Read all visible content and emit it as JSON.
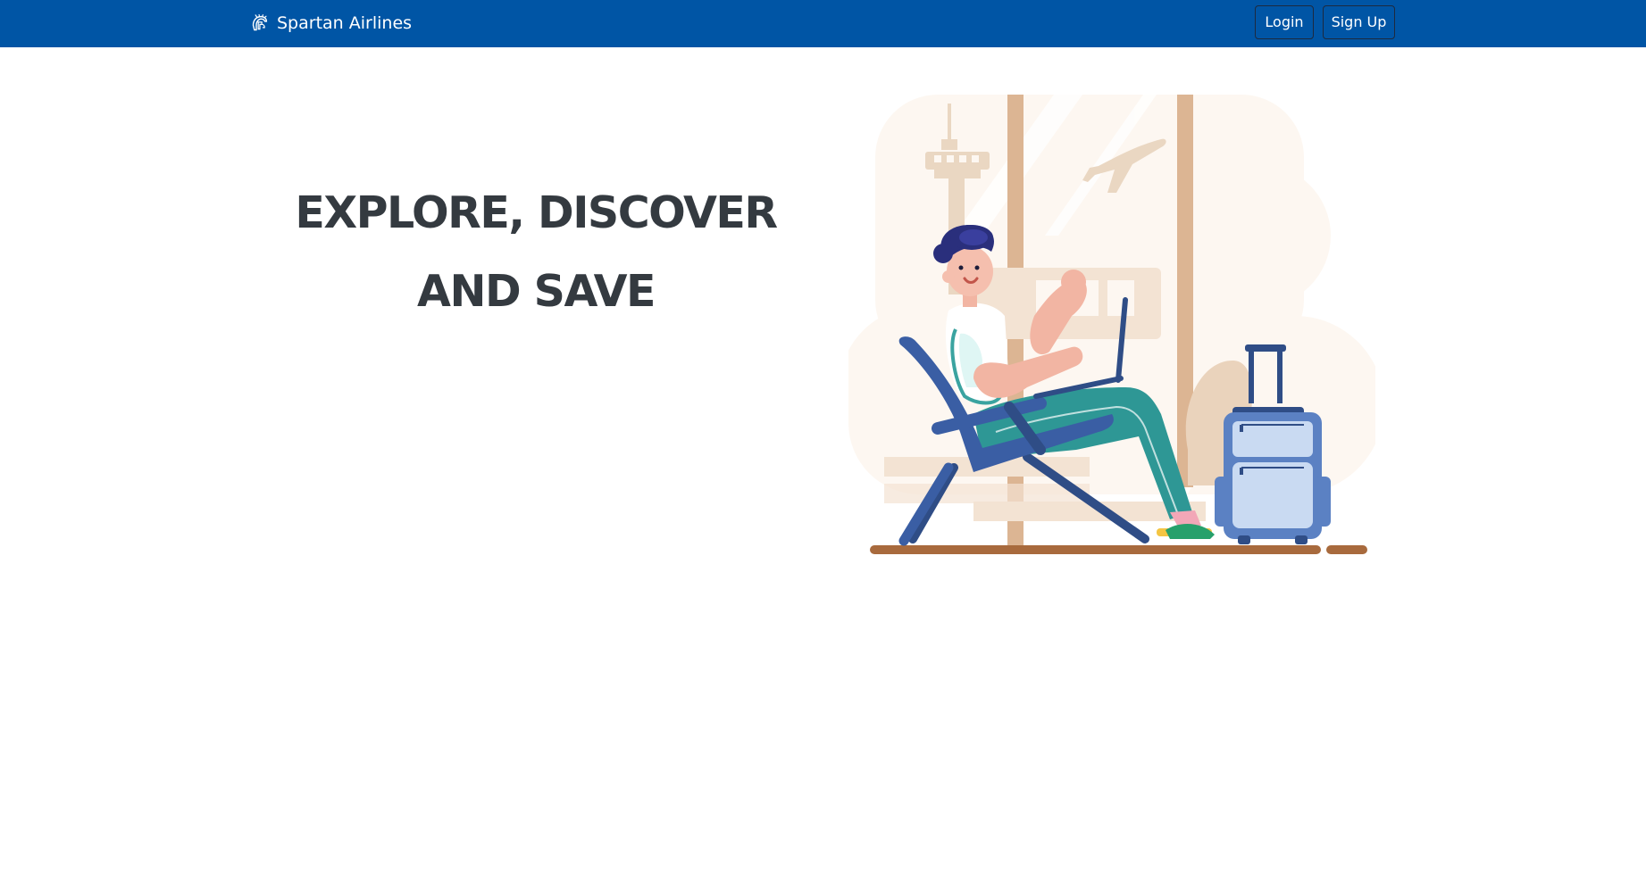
{
  "navbar": {
    "brand_name": "Spartan Airlines",
    "brand_icon": "spartan-helmet-icon",
    "login_label": "Login",
    "signup_label": "Sign Up",
    "background_color": "#0055a5"
  },
  "hero": {
    "title_line1": "EXPLORE, DISCOVER",
    "title_line2": "AND SAVE",
    "text_color": "#343a40",
    "illustration": "traveler-with-laptop-in-airport-lounge-illustration"
  }
}
